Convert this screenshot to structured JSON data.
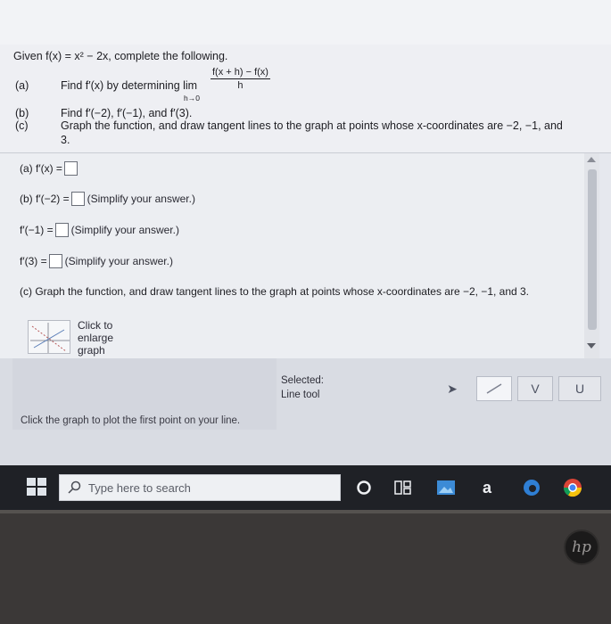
{
  "question": {
    "intro": "Given f(x) = x² − 2x, complete the following.",
    "part_a_letter": "(a)",
    "part_a_text": "Find f′(x) by determining lim",
    "limit_numerator": "f(x + h) − f(x)",
    "limit_denominator": "h",
    "limit_subscript": "h→0",
    "part_b_letter": "(b)",
    "part_b_text": "Find f′(−2), f′(−1), and f′(3).",
    "part_c_letter": "(c)",
    "part_c_text_1": "Graph the function, and draw tangent lines to the graph at points whose x-coordinates are −2, −1, and",
    "part_c_text_2": "3."
  },
  "answer": {
    "a_label": "(a) f′(x) =",
    "b1_label": "(b) f′(−2) =",
    "b2_label": "f′(−1) =",
    "b3_label": "f′(3) =",
    "simplify_hint": "(Simplify your answer.)",
    "c_text": "(c) Graph the function, and draw tangent lines to the graph at points whose x-coordinates are −2, −1, and 3.",
    "enlarge_line1": "Click to",
    "enlarge_line2": "enlarge",
    "enlarge_line3": "graph"
  },
  "graph_tools": {
    "selected_label": "Selected:",
    "selected_tool": "Line tool",
    "status": "Click the graph to plot the first point on your line.",
    "tools": [
      "pointer-icon",
      "line-tool-icon",
      "check-tool-icon",
      "curve-tool-icon"
    ]
  },
  "taskbar": {
    "search_placeholder": "Type here to search",
    "icons": [
      "cortana-icon",
      "task-view-icon",
      "photos-icon",
      "amazon-icon",
      "edge-icon",
      "chrome-icon"
    ]
  },
  "branding": {
    "logo": "hp"
  }
}
